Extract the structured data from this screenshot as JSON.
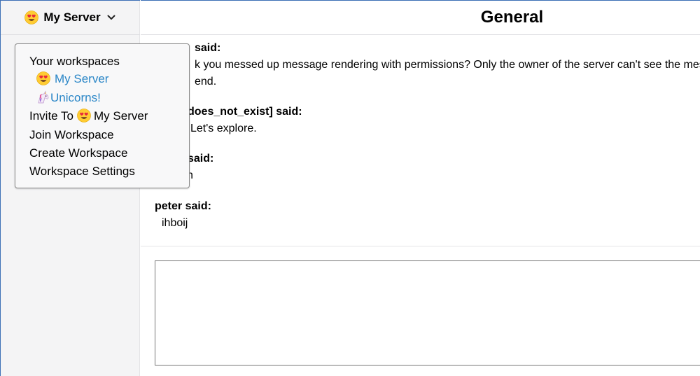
{
  "sidebar": {
    "server_header": {
      "emoji": "heart-eyes-emoji",
      "name": "My Server",
      "chevron": "chevron-down-icon"
    }
  },
  "channel": {
    "title": "General"
  },
  "messages": [
    {
      "author_label": "said:",
      "body": "k you messed up message rendering with permissions? Only the owner of the server can't see the mess end."
    },
    {
      "author_label": "does_not_exist] said:",
      "body": "Let's explore."
    },
    {
      "author_label": "said:",
      "body": "h"
    },
    {
      "author_label": "peter said:",
      "body": "ihboij"
    }
  ],
  "composer": {
    "value": "",
    "placeholder": ""
  },
  "dropdown": {
    "workspaces_heading": "Your workspaces",
    "workspaces": [
      {
        "emoji": "heart-eyes-emoji",
        "name": "My Server"
      },
      {
        "emoji": "unicorn-emoji",
        "name": "Unicorns!"
      }
    ],
    "invite_prefix": "Invite To",
    "invite_server": "My Server",
    "join_label": "Join Workspace",
    "create_label": "Create Workspace",
    "settings_label": "Workspace Settings"
  },
  "colors": {
    "accent_link": "#2a86c7",
    "sidebar_bg": "#f4f4f5",
    "window_border": "#3b6fb5"
  }
}
